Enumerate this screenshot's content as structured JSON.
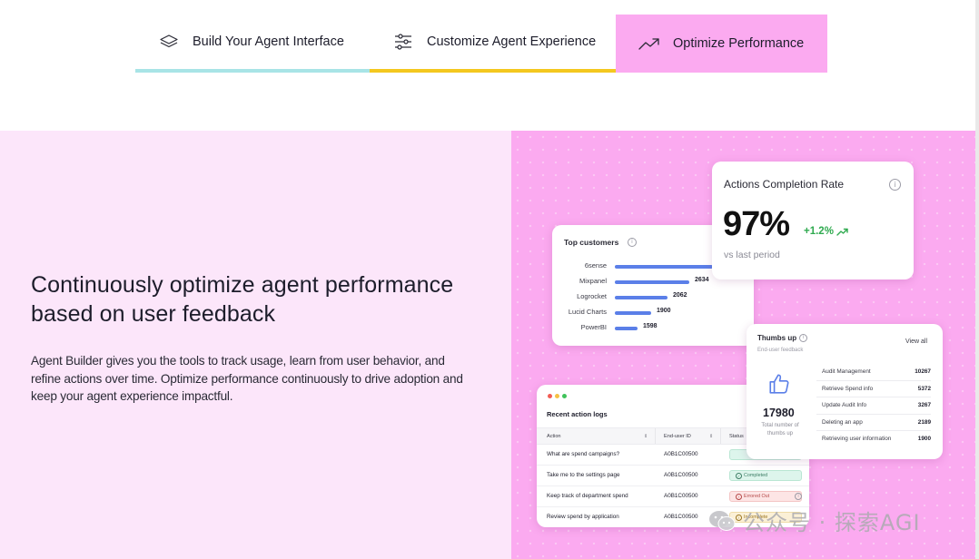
{
  "tabs": [
    {
      "label": "Build Your Agent Interface",
      "icon": "layers-icon",
      "underline_color": "#a8e4e6"
    },
    {
      "label": "Customize Agent Experience",
      "icon": "sliders-icon",
      "underline_color": "#f4c81f"
    },
    {
      "label": "Optimize Performance",
      "icon": "trending-up-icon",
      "active": true,
      "background_color": "#fbaaf0"
    }
  ],
  "content": {
    "headline": "Continuously optimize agent performance based on user feedback",
    "body": "Agent Builder gives you the tools to track usage, learn from user behavior, and refine actions over time. Optimize performance continuously to drive adoption and keep your agent experience impactful."
  },
  "actions_card": {
    "title": "Actions Completion Rate",
    "value": "97%",
    "delta": "+1.2%",
    "subtitle": "vs last period"
  },
  "top_customers": {
    "title": "Top customers",
    "rows": [
      {
        "name": "6sense",
        "value": "",
        "fraction": 1.0
      },
      {
        "name": "Mixpanel",
        "value": "2634",
        "fraction": 0.76
      },
      {
        "name": "Logrocket",
        "value": "2062",
        "fraction": 0.54
      },
      {
        "name": "Lucid Charts",
        "value": "1900",
        "fraction": 0.37
      },
      {
        "name": "PowerBI",
        "value": "1598",
        "fraction": 0.23
      }
    ]
  },
  "thumbs_up": {
    "title": "Thumbs up",
    "subtitle": "End-user feedback",
    "view_all": "View all",
    "total": "17980",
    "caption": "Total number of thumbs up",
    "items": [
      {
        "label": "Audit Management",
        "value": "10267"
      },
      {
        "label": "Retrieve Spend info",
        "value": "5372"
      },
      {
        "label": "Update Audit Info",
        "value": "3267"
      },
      {
        "label": "Deleting an app",
        "value": "2189"
      },
      {
        "label": "Retrieving user information",
        "value": "1900"
      }
    ]
  },
  "action_logs": {
    "title": "Recent action logs",
    "headers": {
      "action": "Action",
      "user": "End-user ID",
      "status": "Status"
    },
    "rows": [
      {
        "action": "What are spend campaigns?",
        "user": "A0B1C00500",
        "status": "",
        "status_type": "green"
      },
      {
        "action": "Take me to the settings page",
        "user": "A0B1C00500",
        "status": "Completed",
        "status_type": "green"
      },
      {
        "action": "Keep track of department spend",
        "user": "A0B1C00500",
        "status": "Errored Out",
        "status_type": "red"
      },
      {
        "action": "Review spend by application",
        "user": "A0B1C00500",
        "status": "Incomplete",
        "status_type": "amber"
      }
    ]
  },
  "watermark": "公众号 · 探索AGI",
  "colors": {
    "accent_pink": "#fbaaf0",
    "section_bg": "#fce6fa",
    "bar_blue": "#5b7fe8",
    "positive_green": "#2faa4f"
  }
}
